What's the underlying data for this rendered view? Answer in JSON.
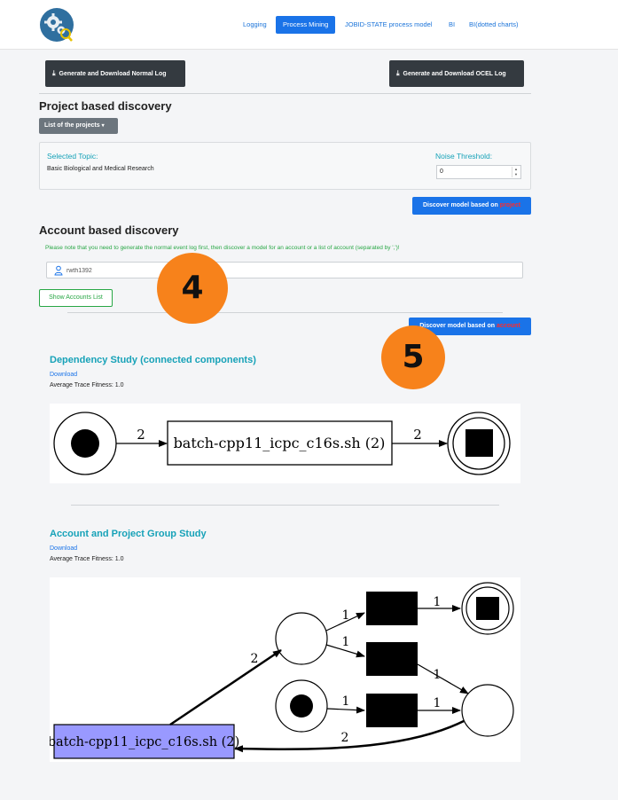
{
  "nav": {
    "items": [
      {
        "label": "Logging",
        "active": false
      },
      {
        "label": "Process Mining",
        "active": true
      },
      {
        "label": "JOBID-STATE process model",
        "active": false
      },
      {
        "label": "BI",
        "active": false
      },
      {
        "label": "BI(dotted charts)",
        "active": false
      }
    ]
  },
  "toolbar": {
    "normal_log_label": "Generate and Download Normal Log",
    "ocel_log_label": "Generate and Download OCEL Log"
  },
  "project_discovery": {
    "title": "Project based discovery",
    "projects_dropdown_label": "List of the projects",
    "selected_topic_label": "Selected Topic:",
    "selected_topic_value": "Basic Biological and Medical Research",
    "noise_label": "Noise Threshold:",
    "noise_value": "0",
    "discover_prefix": "Discover model based on ",
    "discover_highlight": "project"
  },
  "account_discovery": {
    "title": "Account based discovery",
    "note": "Please note that you need to generate the normal event log first, then discover a model for an account or a list of account (separated by ',')!",
    "account_value": "rwth1392",
    "show_accounts_label": "Show Accounts List",
    "discover_prefix": "Discover model based on ",
    "discover_highlight": "account"
  },
  "badges": {
    "four": "4",
    "five": "5"
  },
  "dependency_study": {
    "title": "Dependency Study (connected components)",
    "download_label": "Download",
    "fitness_text": "Average Trace Fitness: 1.0",
    "graph": {
      "transition_label": "batch-cpp11_icpc_c16s.sh (2)",
      "arc_labels": [
        "2",
        "2"
      ]
    }
  },
  "group_study": {
    "title": "Account and Project Group Study",
    "download_label": "Download",
    "fitness_text": "Average Trace Fitness: 1.0",
    "graph": {
      "transition_label": "batch-cpp11_icpc_c16s.sh (2)",
      "arc_labels": [
        "2",
        "1",
        "1",
        "1",
        "1",
        "1",
        "1",
        "2"
      ]
    }
  },
  "colors": {
    "primary": "#1a73e8",
    "teal": "#17a2b8",
    "success": "#28a745",
    "dark": "#343a40",
    "badge": "#f7821b",
    "highlight": "#ff2b2b",
    "transition_fill": "#9999ff"
  }
}
